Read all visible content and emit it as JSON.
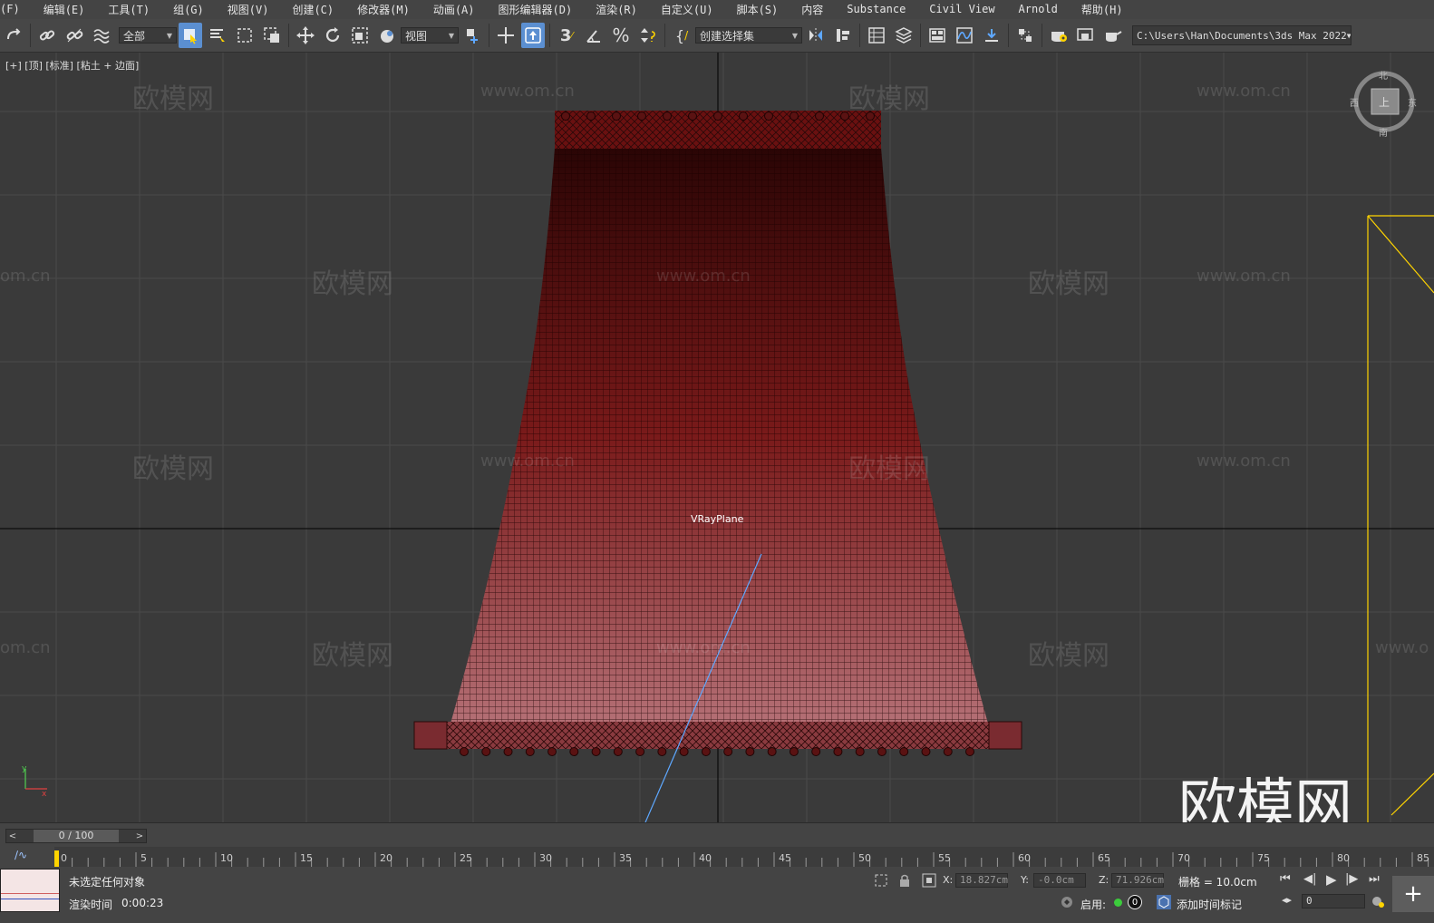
{
  "menu": [
    "(F)",
    "编辑(E)",
    "工具(T)",
    "组(G)",
    "视图(V)",
    "创建(C)",
    "修改器(M)",
    "动画(A)",
    "图形编辑器(D)",
    "渲染(R)",
    "自定义(U)",
    "脚本(S)",
    "内容",
    "Substance",
    "Civil View",
    "Arnold",
    "帮助(H)"
  ],
  "toolbar": {
    "selection_filter": "全部",
    "coord_system": "视图",
    "selection_set": "创建选择集",
    "project_path": "C:\\Users\\Han\\Documents\\3ds Max 2022"
  },
  "viewport": {
    "label": "[+] [顶] [标准] [粘土 + 边面]",
    "object_label": "VRayPlane",
    "watermark_url": "www.om.cn",
    "watermark_brand": "欧模网",
    "watermark_partial_left": "om.cn",
    "watermark_partial_right": "www.o",
    "big_watermark": "欧模网",
    "viewcube": {
      "face": "上",
      "north": "北",
      "south": "南",
      "east": "东",
      "west": "西"
    },
    "colors": {
      "mesh_top": "#2a0505",
      "mesh_bottom": "#b46f75",
      "wire": "#1a0000",
      "grid": "#4a4a4a",
      "axis": "#000000",
      "camera": "#ffd400",
      "target_line": "#5ea8ff"
    }
  },
  "timeline": {
    "frame_display": "0 / 100",
    "ruler": [
      "0",
      "5",
      "10",
      "15",
      "20",
      "25",
      "30",
      "35",
      "40",
      "45",
      "50",
      "55",
      "60",
      "65",
      "70",
      "75",
      "80",
      "85"
    ],
    "current_frame": 0
  },
  "status": {
    "selection": "未选定任何对象",
    "render_time_label": "渲染时间",
    "render_time_value": "0:00:23",
    "x_label": "X:",
    "x_value": "18.827cm",
    "y_label": "Y:",
    "y_value": "-0.0cm",
    "z_label": "Z:",
    "z_value": "71.926cm",
    "grid_label": "栅格 = 10.0cm",
    "enable_label": "启用:",
    "badge_value": "0",
    "add_time_tag": "添加时间标记",
    "frame_value": "0"
  }
}
